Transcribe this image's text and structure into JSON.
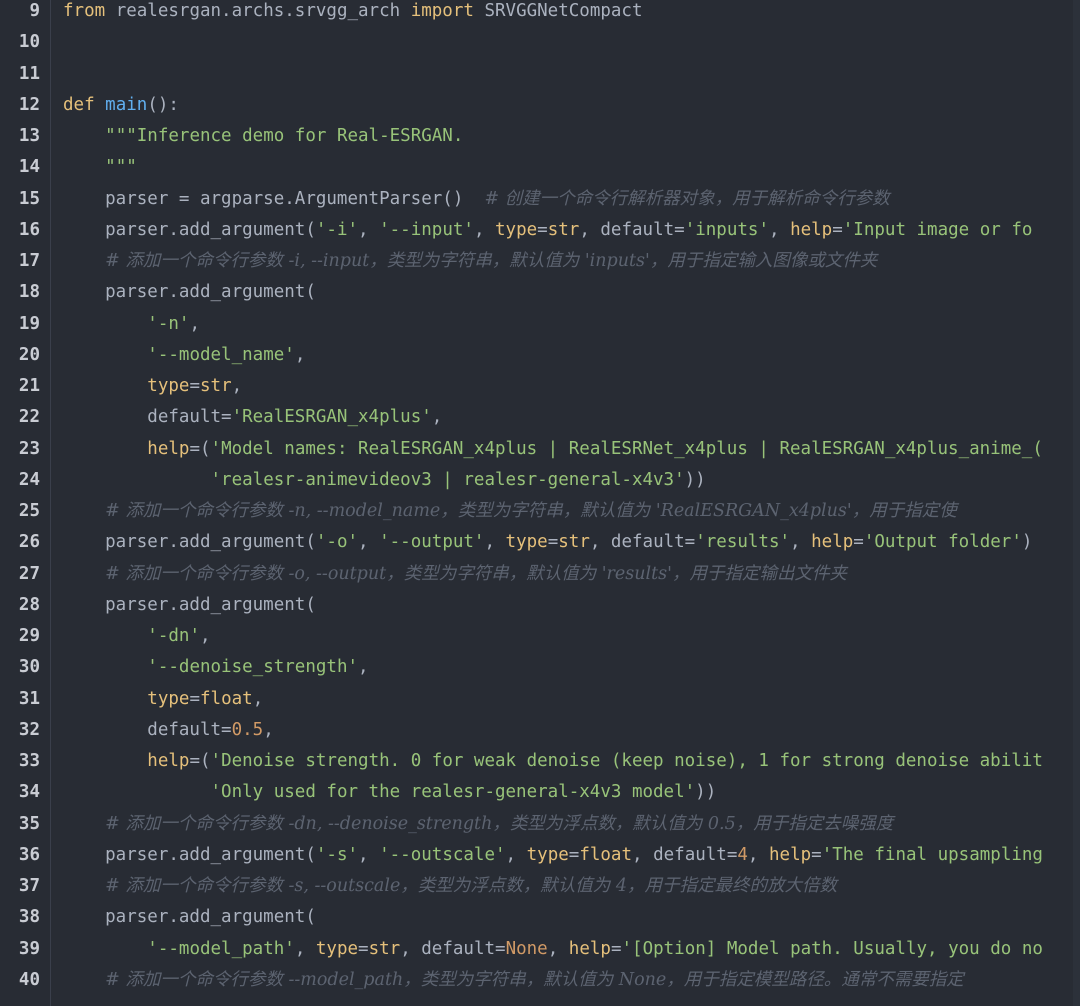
{
  "colors": {
    "background": "#282c34",
    "keyword": "#e5c07b",
    "function": "#61afef",
    "string": "#98c379",
    "number": "#d19a66",
    "comment": "#5c6370",
    "text": "#abb2bf",
    "line_number": "#c9ccd3"
  },
  "lines": [
    {
      "n": "9",
      "tokens": [
        {
          "c": "kw",
          "t": "from"
        },
        {
          "c": "plain",
          "t": " realesrgan.archs.srvgg_arch "
        },
        {
          "c": "kw",
          "t": "import"
        },
        {
          "c": "plain",
          "t": " SRVGGNetCompact"
        }
      ]
    },
    {
      "n": "10",
      "tokens": []
    },
    {
      "n": "11",
      "tokens": []
    },
    {
      "n": "12",
      "tokens": [
        {
          "c": "kw",
          "t": "def"
        },
        {
          "c": "plain",
          "t": " "
        },
        {
          "c": "fn",
          "t": "main"
        },
        {
          "c": "plain",
          "t": "():"
        }
      ]
    },
    {
      "n": "13",
      "tokens": [
        {
          "c": "plain",
          "t": "    "
        },
        {
          "c": "str",
          "t": "\"\"\"Inference demo for Real-ESRGAN."
        }
      ]
    },
    {
      "n": "14",
      "tokens": [
        {
          "c": "plain",
          "t": "    "
        },
        {
          "c": "str",
          "t": "\"\"\""
        }
      ]
    },
    {
      "n": "15",
      "tokens": [
        {
          "c": "plain",
          "t": "    parser = argparse.ArgumentParser()  "
        },
        {
          "c": "cm",
          "t": "# 创建一个命令行解析器对象，用于解析命令行参数"
        }
      ]
    },
    {
      "n": "16",
      "tokens": [
        {
          "c": "plain",
          "t": "    parser.add_argument("
        },
        {
          "c": "str",
          "t": "'-i'"
        },
        {
          "c": "plain",
          "t": ", "
        },
        {
          "c": "str",
          "t": "'--input'"
        },
        {
          "c": "plain",
          "t": ", "
        },
        {
          "c": "kw",
          "t": "type"
        },
        {
          "c": "plain",
          "t": "="
        },
        {
          "c": "kw",
          "t": "str"
        },
        {
          "c": "plain",
          "t": ", default="
        },
        {
          "c": "str",
          "t": "'inputs'"
        },
        {
          "c": "plain",
          "t": ", "
        },
        {
          "c": "kw",
          "t": "help"
        },
        {
          "c": "plain",
          "t": "="
        },
        {
          "c": "str",
          "t": "'Input image or fo"
        }
      ]
    },
    {
      "n": "17",
      "tokens": [
        {
          "c": "plain",
          "t": "    "
        },
        {
          "c": "cm",
          "t": "# 添加一个命令行参数 -i, --input，类型为字符串，默认值为 'inputs'，用于指定输入图像或文件夹"
        }
      ]
    },
    {
      "n": "18",
      "tokens": [
        {
          "c": "plain",
          "t": "    parser.add_argument("
        }
      ]
    },
    {
      "n": "19",
      "tokens": [
        {
          "c": "plain",
          "t": "        "
        },
        {
          "c": "str",
          "t": "'-n'"
        },
        {
          "c": "plain",
          "t": ","
        }
      ]
    },
    {
      "n": "20",
      "tokens": [
        {
          "c": "plain",
          "t": "        "
        },
        {
          "c": "str",
          "t": "'--model_name'"
        },
        {
          "c": "plain",
          "t": ","
        }
      ]
    },
    {
      "n": "21",
      "tokens": [
        {
          "c": "plain",
          "t": "        "
        },
        {
          "c": "kw",
          "t": "type"
        },
        {
          "c": "plain",
          "t": "="
        },
        {
          "c": "kw",
          "t": "str"
        },
        {
          "c": "plain",
          "t": ","
        }
      ]
    },
    {
      "n": "22",
      "tokens": [
        {
          "c": "plain",
          "t": "        default="
        },
        {
          "c": "str",
          "t": "'RealESRGAN_x4plus'"
        },
        {
          "c": "plain",
          "t": ","
        }
      ]
    },
    {
      "n": "23",
      "tokens": [
        {
          "c": "plain",
          "t": "        "
        },
        {
          "c": "kw",
          "t": "help"
        },
        {
          "c": "plain",
          "t": "=("
        },
        {
          "c": "str",
          "t": "'Model names: RealESRGAN_x4plus | RealESRNet_x4plus | RealESRGAN_x4plus_anime_("
        }
      ]
    },
    {
      "n": "24",
      "tokens": [
        {
          "c": "plain",
          "t": "              "
        },
        {
          "c": "str",
          "t": "'realesr-animevideov3 | realesr-general-x4v3'"
        },
        {
          "c": "plain",
          "t": "))"
        }
      ]
    },
    {
      "n": "25",
      "tokens": [
        {
          "c": "plain",
          "t": "    "
        },
        {
          "c": "cm",
          "t": "# 添加一个命令行参数 -n, --model_name，类型为字符串，默认值为 'RealESRGAN_x4plus'，用于指定使"
        }
      ]
    },
    {
      "n": "26",
      "tokens": [
        {
          "c": "plain",
          "t": "    parser.add_argument("
        },
        {
          "c": "str",
          "t": "'-o'"
        },
        {
          "c": "plain",
          "t": ", "
        },
        {
          "c": "str",
          "t": "'--output'"
        },
        {
          "c": "plain",
          "t": ", "
        },
        {
          "c": "kw",
          "t": "type"
        },
        {
          "c": "plain",
          "t": "="
        },
        {
          "c": "kw",
          "t": "str"
        },
        {
          "c": "plain",
          "t": ", default="
        },
        {
          "c": "str",
          "t": "'results'"
        },
        {
          "c": "plain",
          "t": ", "
        },
        {
          "c": "kw",
          "t": "help"
        },
        {
          "c": "plain",
          "t": "="
        },
        {
          "c": "str",
          "t": "'Output folder'"
        },
        {
          "c": "plain",
          "t": ")"
        }
      ]
    },
    {
      "n": "27",
      "tokens": [
        {
          "c": "plain",
          "t": "    "
        },
        {
          "c": "cm",
          "t": "# 添加一个命令行参数 -o, --output，类型为字符串，默认值为 'results'，用于指定输出文件夹"
        }
      ]
    },
    {
      "n": "28",
      "tokens": [
        {
          "c": "plain",
          "t": "    parser.add_argument("
        }
      ]
    },
    {
      "n": "29",
      "tokens": [
        {
          "c": "plain",
          "t": "        "
        },
        {
          "c": "str",
          "t": "'-dn'"
        },
        {
          "c": "plain",
          "t": ","
        }
      ]
    },
    {
      "n": "30",
      "tokens": [
        {
          "c": "plain",
          "t": "        "
        },
        {
          "c": "str",
          "t": "'--denoise_strength'"
        },
        {
          "c": "plain",
          "t": ","
        }
      ]
    },
    {
      "n": "31",
      "tokens": [
        {
          "c": "plain",
          "t": "        "
        },
        {
          "c": "kw",
          "t": "type"
        },
        {
          "c": "plain",
          "t": "="
        },
        {
          "c": "kw",
          "t": "float"
        },
        {
          "c": "plain",
          "t": ","
        }
      ]
    },
    {
      "n": "32",
      "tokens": [
        {
          "c": "plain",
          "t": "        default="
        },
        {
          "c": "num",
          "t": "0.5"
        },
        {
          "c": "plain",
          "t": ","
        }
      ]
    },
    {
      "n": "33",
      "tokens": [
        {
          "c": "plain",
          "t": "        "
        },
        {
          "c": "kw",
          "t": "help"
        },
        {
          "c": "plain",
          "t": "=("
        },
        {
          "c": "str",
          "t": "'Denoise strength. 0 for weak denoise (keep noise), 1 for strong denoise abilit"
        }
      ]
    },
    {
      "n": "34",
      "tokens": [
        {
          "c": "plain",
          "t": "              "
        },
        {
          "c": "str",
          "t": "'Only used for the realesr-general-x4v3 model'"
        },
        {
          "c": "plain",
          "t": "))"
        }
      ]
    },
    {
      "n": "35",
      "tokens": [
        {
          "c": "plain",
          "t": "    "
        },
        {
          "c": "cm",
          "t": "# 添加一个命令行参数 -dn, --denoise_strength，类型为浮点数，默认值为 0.5，用于指定去噪强度"
        }
      ]
    },
    {
      "n": "36",
      "tokens": [
        {
          "c": "plain",
          "t": "    parser.add_argument("
        },
        {
          "c": "str",
          "t": "'-s'"
        },
        {
          "c": "plain",
          "t": ", "
        },
        {
          "c": "str",
          "t": "'--outscale'"
        },
        {
          "c": "plain",
          "t": ", "
        },
        {
          "c": "kw",
          "t": "type"
        },
        {
          "c": "plain",
          "t": "="
        },
        {
          "c": "kw",
          "t": "float"
        },
        {
          "c": "plain",
          "t": ", default="
        },
        {
          "c": "num",
          "t": "4"
        },
        {
          "c": "plain",
          "t": ", "
        },
        {
          "c": "kw",
          "t": "help"
        },
        {
          "c": "plain",
          "t": "="
        },
        {
          "c": "str",
          "t": "'The final upsampling"
        }
      ]
    },
    {
      "n": "37",
      "tokens": [
        {
          "c": "plain",
          "t": "    "
        },
        {
          "c": "cm",
          "t": "# 添加一个命令行参数 -s, --outscale，类型为浮点数，默认值为 4，用于指定最终的放大倍数"
        }
      ]
    },
    {
      "n": "38",
      "tokens": [
        {
          "c": "plain",
          "t": "    parser.add_argument("
        }
      ]
    },
    {
      "n": "39",
      "tokens": [
        {
          "c": "plain",
          "t": "        "
        },
        {
          "c": "str",
          "t": "'--model_path'"
        },
        {
          "c": "plain",
          "t": ", "
        },
        {
          "c": "kw",
          "t": "type"
        },
        {
          "c": "plain",
          "t": "="
        },
        {
          "c": "kw",
          "t": "str"
        },
        {
          "c": "plain",
          "t": ", default="
        },
        {
          "c": "num",
          "t": "None"
        },
        {
          "c": "plain",
          "t": ", "
        },
        {
          "c": "kw",
          "t": "help"
        },
        {
          "c": "plain",
          "t": "="
        },
        {
          "c": "str",
          "t": "'[Option] Model path. Usually, you do no"
        }
      ]
    },
    {
      "n": "40",
      "tokens": [
        {
          "c": "plain",
          "t": "    "
        },
        {
          "c": "cm",
          "t": "# 添加一个命令行参数 --model_path，类型为字符串，默认值为 None，用于指定模型路径。通常不需要指定"
        }
      ]
    }
  ]
}
